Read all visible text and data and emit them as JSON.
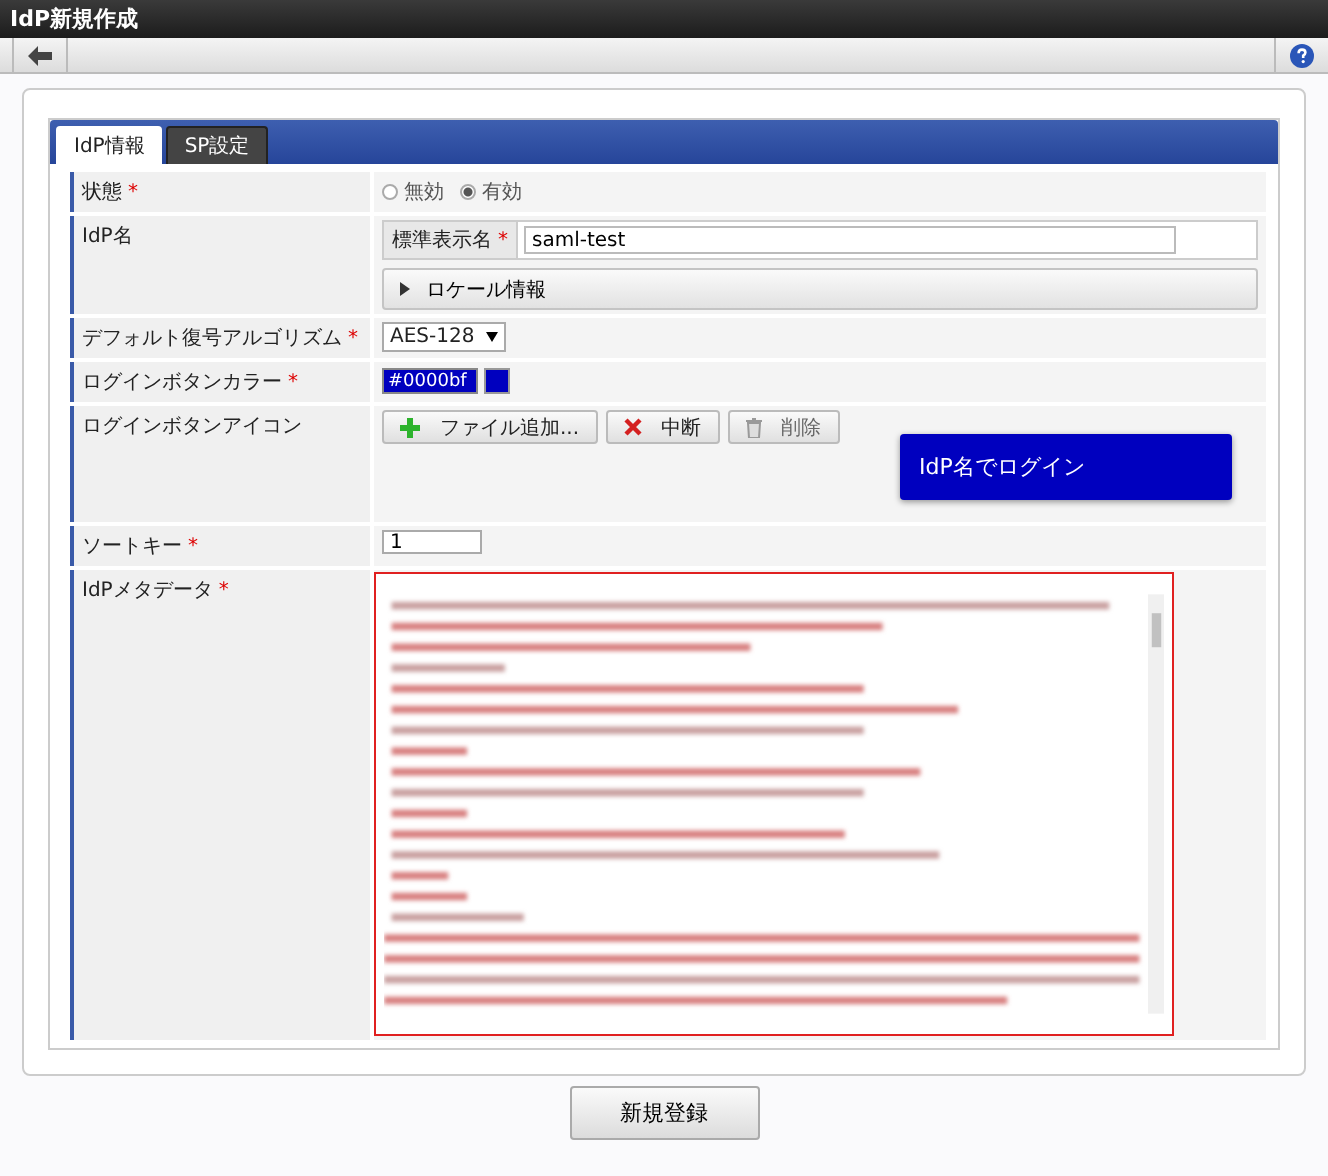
{
  "window": {
    "title": "IdP新規作成"
  },
  "tabs": [
    {
      "label": "IdP情報",
      "selected": true
    },
    {
      "label": "SP設定",
      "selected": false
    }
  ],
  "rows": [
    {
      "kind": "radio",
      "label": "状態",
      "required_mark": "*",
      "options": [
        {
          "label": "無効",
          "selected": false
        },
        {
          "label": "有効",
          "selected": true
        }
      ]
    },
    {
      "kind": "name",
      "label": "IdP名",
      "sublabel": "標準表示名",
      "sublabel_mark": "*",
      "value": "saml-test",
      "expander": {
        "label": "ロケール情報",
        "expanded": false
      }
    },
    {
      "kind": "select",
      "label": "デフォルト復号アルゴリズム",
      "required_mark": "*",
      "value": "AES-128"
    },
    {
      "kind": "color",
      "label": "ログインボタンカラー",
      "required_mark": "*",
      "value": "#0000bf"
    },
    {
      "kind": "file",
      "label": "ログインボタンアイコン",
      "buttons": [
        {
          "label": "ファイル追加...",
          "disabled": false
        },
        {
          "label": "中断",
          "disabled": false
        },
        {
          "label": "削除",
          "disabled": true
        }
      ],
      "preview": "IdP名でログイン"
    },
    {
      "kind": "text",
      "label": "ソートキー",
      "required_mark": "*",
      "value": "1"
    },
    {
      "kind": "textarea",
      "label": "IdPメタデータ",
      "required_mark": "*",
      "error": true
    }
  ],
  "submit": "新規登録"
}
